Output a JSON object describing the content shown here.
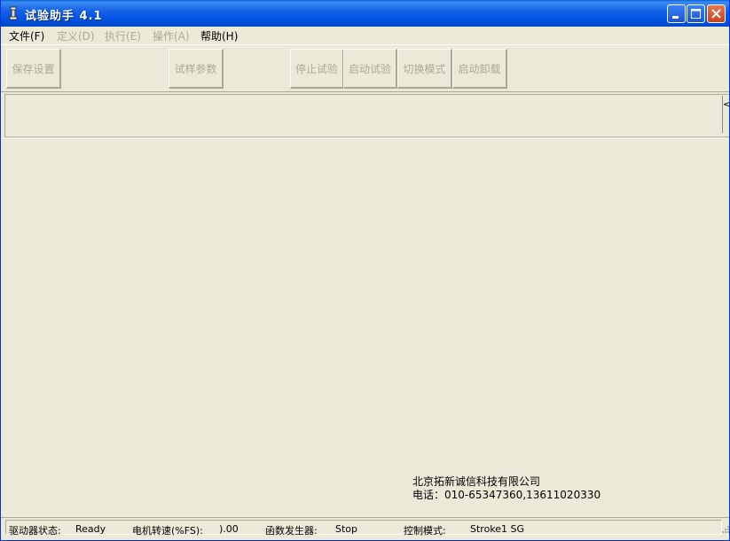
{
  "window": {
    "title": "试验助手 4.1",
    "controls": {
      "minimize": "minimize",
      "maximize": "maximize",
      "close": "close"
    },
    "colors": {
      "titlebar": "#0054e3",
      "background": "#ece9d8",
      "disabled_text": "#aca899"
    }
  },
  "menu": {
    "items": [
      {
        "label": "文件(F)",
        "enabled": true
      },
      {
        "label": "定义(D)",
        "enabled": false
      },
      {
        "label": "执行(E)",
        "enabled": false
      },
      {
        "label": "操作(A)",
        "enabled": false
      },
      {
        "label": "帮助(H)",
        "enabled": true
      }
    ]
  },
  "toolbar": {
    "buttons": [
      {
        "label": "保存设置",
        "enabled": false
      },
      {
        "label": "试样参数",
        "enabled": false
      },
      {
        "label": "停止试验",
        "enabled": false
      },
      {
        "label": "启动试验",
        "enabled": false
      },
      {
        "label": "切换模式",
        "enabled": false
      },
      {
        "label": "启动卸载",
        "enabled": false
      }
    ]
  },
  "company": {
    "name": "北京拓新诚信科技有限公司",
    "phone": "电话：010-65347360,13611020330"
  },
  "statusbar": {
    "driver_label": "驱动器状态:",
    "driver_value": "Ready",
    "motor_label": "电机转速(%FS):",
    "motor_value": ").00",
    "generator_label": "函数发生器:",
    "generator_value": "Stop",
    "control_label": "控制模式:",
    "control_value": "Stroke1 SG"
  }
}
